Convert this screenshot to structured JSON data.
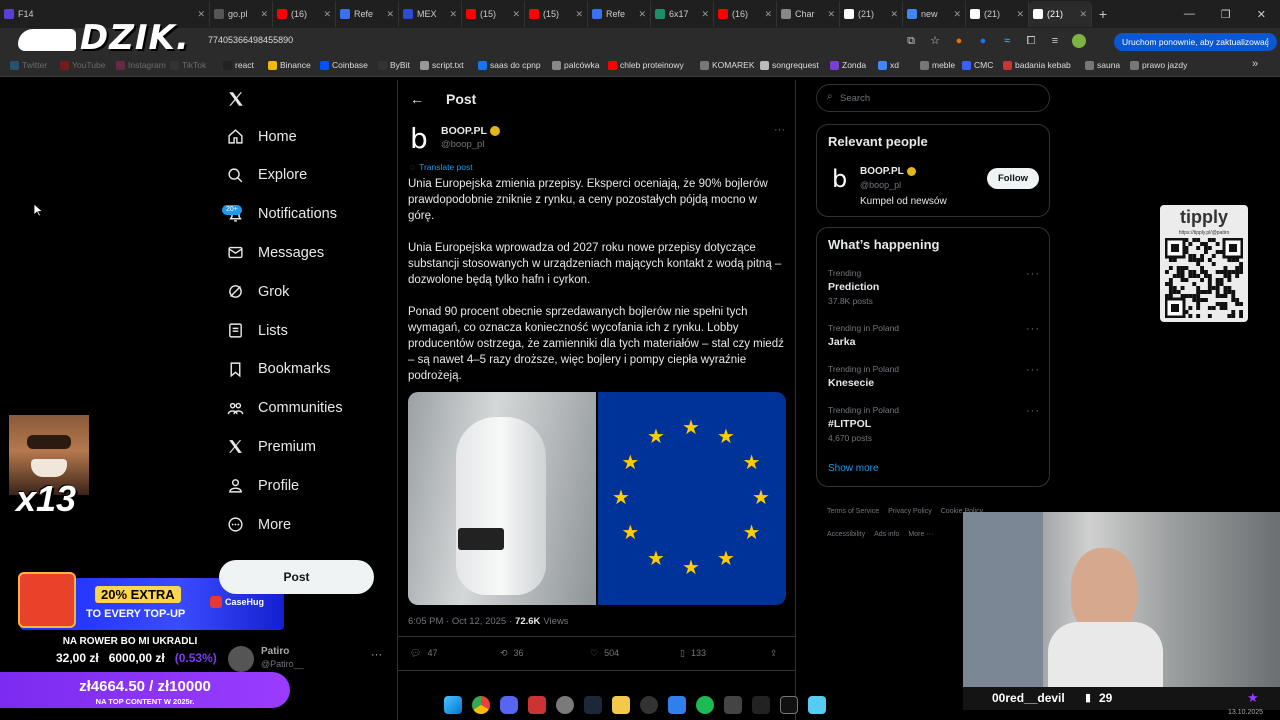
{
  "browser": {
    "tabs": [
      {
        "title": "F14",
        "color": "#5a3fd6"
      },
      {
        "title": "go.pl",
        "color": "#555555"
      },
      {
        "title": "(16)",
        "color": "#ff0000"
      },
      {
        "title": "Refe",
        "color": "#3b6ff5"
      },
      {
        "title": "MEX",
        "color": "#2b4bd8"
      },
      {
        "title": "(15)",
        "color": "#ff0000"
      },
      {
        "title": "(15)",
        "color": "#ff0000"
      },
      {
        "title": "Refe",
        "color": "#3b6ff5"
      },
      {
        "title": "6x17",
        "color": "#1a8f6a"
      },
      {
        "title": "(16)",
        "color": "#ff0000"
      },
      {
        "title": "Char",
        "color": "#888888"
      },
      {
        "title": "(21)",
        "color": "#ffffff"
      },
      {
        "title": "new",
        "color": "#4285f4"
      },
      {
        "title": "(21)",
        "color": "#ffffff"
      },
      {
        "title": "(21)",
        "color": "#ffffff"
      }
    ],
    "url": "774053664984558​90",
    "restart_label": "Uruchom ponownie, aby zaktualizować",
    "bookmarks": [
      {
        "label": "Twitter",
        "color": "#1d9bf0"
      },
      {
        "label": "YouTube",
        "color": "#ff0000"
      },
      {
        "label": "Instagram",
        "color": "#d62976"
      },
      {
        "label": "TikTok",
        "color": "#444"
      },
      {
        "label": "react",
        "color": "#222"
      },
      {
        "label": "Binance",
        "color": "#f0b90b"
      },
      {
        "label": "Coinbase",
        "color": "#0052ff"
      },
      {
        "label": "ByBit",
        "color": "#333"
      },
      {
        "label": "script.txt",
        "color": "#999"
      },
      {
        "label": "saas do cpnp",
        "color": "#1a73e8"
      },
      {
        "label": "palcówka",
        "color": "#888"
      },
      {
        "label": "chleb proteinowy",
        "color": "#ff0000"
      },
      {
        "label": "KOMAREK",
        "color": "#777"
      },
      {
        "label": "songrequest",
        "color": "#bbb"
      },
      {
        "label": "Zonda",
        "color": "#7a3fd0"
      },
      {
        "label": "xd",
        "color": "#4285f4"
      },
      {
        "label": "meble",
        "color": "#777"
      },
      {
        "label": "CMC",
        "color": "#3861fb"
      },
      {
        "label": "badania kebab",
        "color": "#c33"
      },
      {
        "label": "sauna",
        "color": "#777"
      },
      {
        "label": "prawo jazdy",
        "color": "#777"
      }
    ]
  },
  "overlay": {
    "logo": "DZIK.",
    "combo": "x13",
    "promo_percent": "20% EXTRA",
    "promo_line": "TO EVERY TOP-UP",
    "promo_brand": "CaseHug",
    "goal_title": "NA ROWER BO MI UKRADLI",
    "goal_current": "32,00 zł",
    "goal_target": "6000,00 zł",
    "goal_pct": "(0.53%)",
    "top_goal": "zł4664.50 / zł10000",
    "top_goal_sub": "NA TOP CONTENT W 2025r.",
    "tipply": "tipply",
    "tipply_url": "https://tipply.pl/@patiro",
    "cam_name": "00red__devil",
    "cam_count": "29",
    "date": "13.10.2025"
  },
  "nav": {
    "items": [
      {
        "label": "Home",
        "icon": "home-icon"
      },
      {
        "label": "Explore",
        "icon": "search-icon"
      },
      {
        "label": "Notifications",
        "icon": "bell-icon"
      },
      {
        "label": "Messages",
        "icon": "mail-icon"
      },
      {
        "label": "Grok",
        "icon": "grok-icon"
      },
      {
        "label": "Lists",
        "icon": "list-icon"
      },
      {
        "label": "Bookmarks",
        "icon": "bookmark-icon"
      },
      {
        "label": "Communities",
        "icon": "communities-icon"
      },
      {
        "label": "Premium",
        "icon": "x-icon"
      },
      {
        "label": "Profile",
        "icon": "profile-icon"
      },
      {
        "label": "More",
        "icon": "more-icon"
      }
    ],
    "badge": "20+",
    "post_button": "Post",
    "account_name": "Patiro",
    "account_handle": "@Patiro__"
  },
  "post": {
    "header": "Post",
    "author": "BOOP.PL",
    "handle": "@boop_pl",
    "translate": "Translate post",
    "paragraphs": [
      "Unia Europejska zmienia przepisy. Eksperci oceniają, że 90% bojlerów prawdopodobnie zniknie z rynku, a ceny pozostałych pójdą mocno w górę.",
      "Unia Europejska wprowadza od 2027 roku nowe przepisy dotyczące substancji stosowanych w urządzeniach mających kontakt z wodą pitną – dozwolone będą tylko hafn i cyrkon.",
      "Ponad 90 procent obecnie sprzedawanych bojlerów nie spełni tych wymagań, co oznacza konieczność wycofania ich z rynku. Lobby producentów ostrzega, że zamienniki dla tych materiałów – stal czy miedź – są nawet 4–5 razy droższe, więc bojlery i pompy ciepła wyraźnie podrożeją."
    ],
    "time": "6:05 PM · Oct 12, 2025 ·",
    "views_count": "72.6K",
    "views_label": "Views",
    "replies": "47",
    "reposts": "36",
    "likes": "504",
    "bookmarks": "133"
  },
  "sidebar": {
    "search_placeholder": "Search",
    "relevant_title": "Relevant people",
    "person_name": "BOOP.PL",
    "person_handle": "@boop_pl",
    "person_bio": "Kumpel od newsów",
    "follow_label": "Follow",
    "happening_title": "What’s happening",
    "trends": [
      {
        "category": "Trending",
        "name": "Prediction",
        "count": "37.8K posts"
      },
      {
        "category": "Trending in Poland",
        "name": "Jarka",
        "count": ""
      },
      {
        "category": "Trending in Poland",
        "name": "Knesecie",
        "count": ""
      },
      {
        "category": "Trending in Poland",
        "name": "#LITPOL",
        "count": "4,670 posts"
      }
    ],
    "show_more": "Show more",
    "footer": [
      "Terms of Service",
      "Privacy Policy",
      "Cookie Policy",
      "Accessibility",
      "Ads info",
      "More ···"
    ]
  }
}
